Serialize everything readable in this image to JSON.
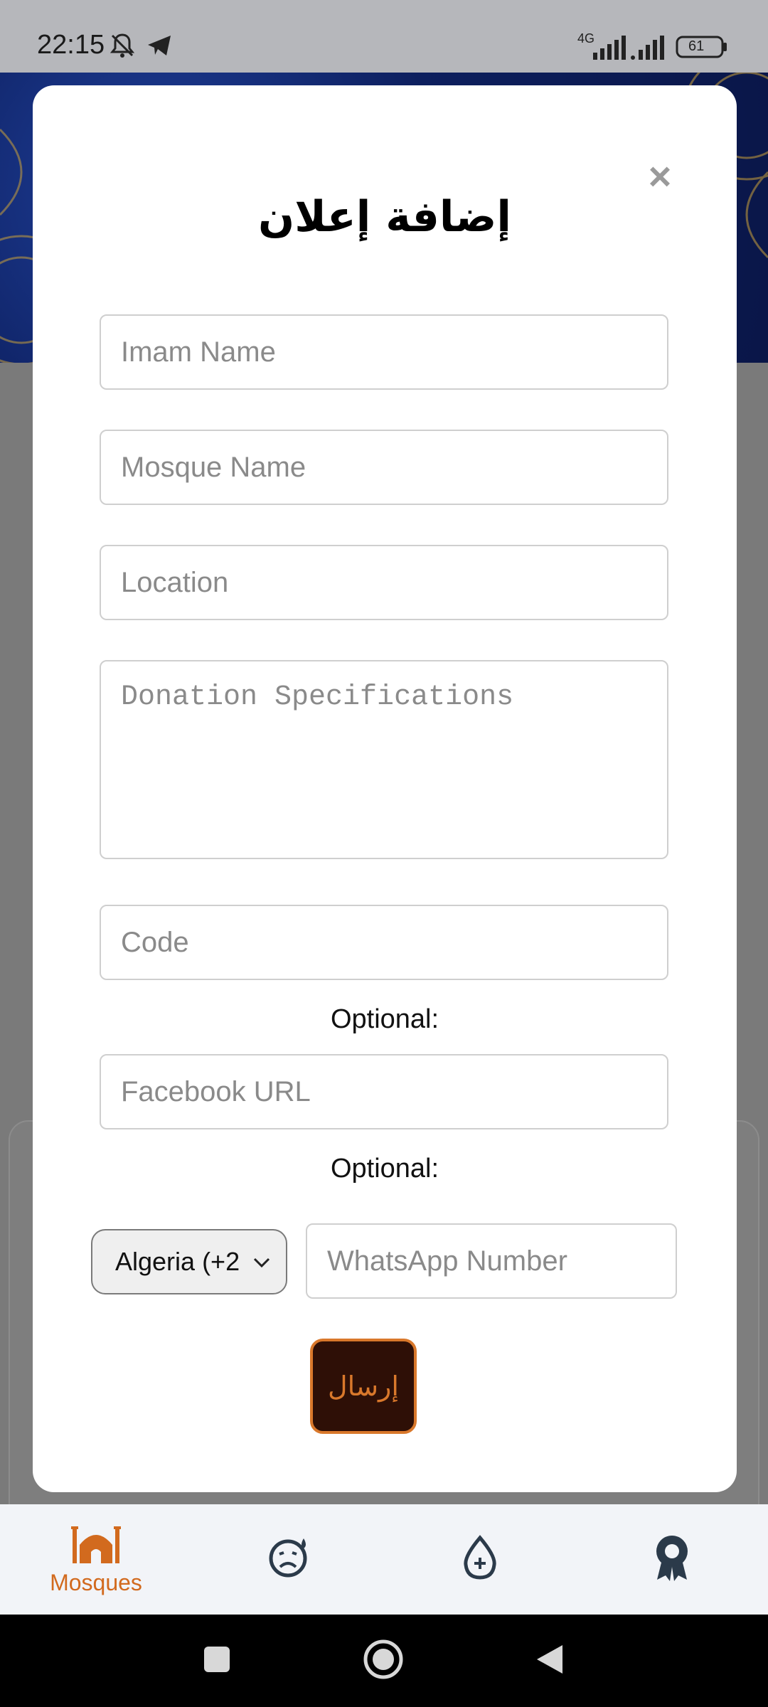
{
  "status_bar": {
    "time": "22:15",
    "network": "4G",
    "battery": "61",
    "icons": [
      "bell-off-icon",
      "telegram-icon",
      "signal-icon",
      "signal-icon",
      "battery-icon"
    ]
  },
  "modal": {
    "title": "إضافة إعلان",
    "close_symbol": "×",
    "fields": {
      "imam_name_placeholder": "Imam Name",
      "mosque_name_placeholder": "Mosque Name",
      "location_placeholder": "Location",
      "donation_placeholder": "Donation Specifications",
      "code_placeholder": "Code",
      "facebook_placeholder": "Facebook URL",
      "whatsapp_placeholder": "WhatsApp Number"
    },
    "optional_label_1": "Optional:",
    "optional_label_2": "Optional:",
    "country_select_value": "Algeria (+2",
    "submit_label": "إرسال"
  },
  "bottom_nav": {
    "items": [
      {
        "label": "Mosques",
        "icon": "mosque-icon",
        "active": true
      },
      {
        "label": "",
        "icon": "sad-face-icon",
        "active": false
      },
      {
        "label": "",
        "icon": "blood-drop-icon",
        "active": false
      },
      {
        "label": "",
        "icon": "award-icon",
        "active": false
      }
    ]
  },
  "colors": {
    "accent": "#d26a1e",
    "submit_bg": "#2e0f06",
    "nav_icon": "#2b3a4a"
  }
}
